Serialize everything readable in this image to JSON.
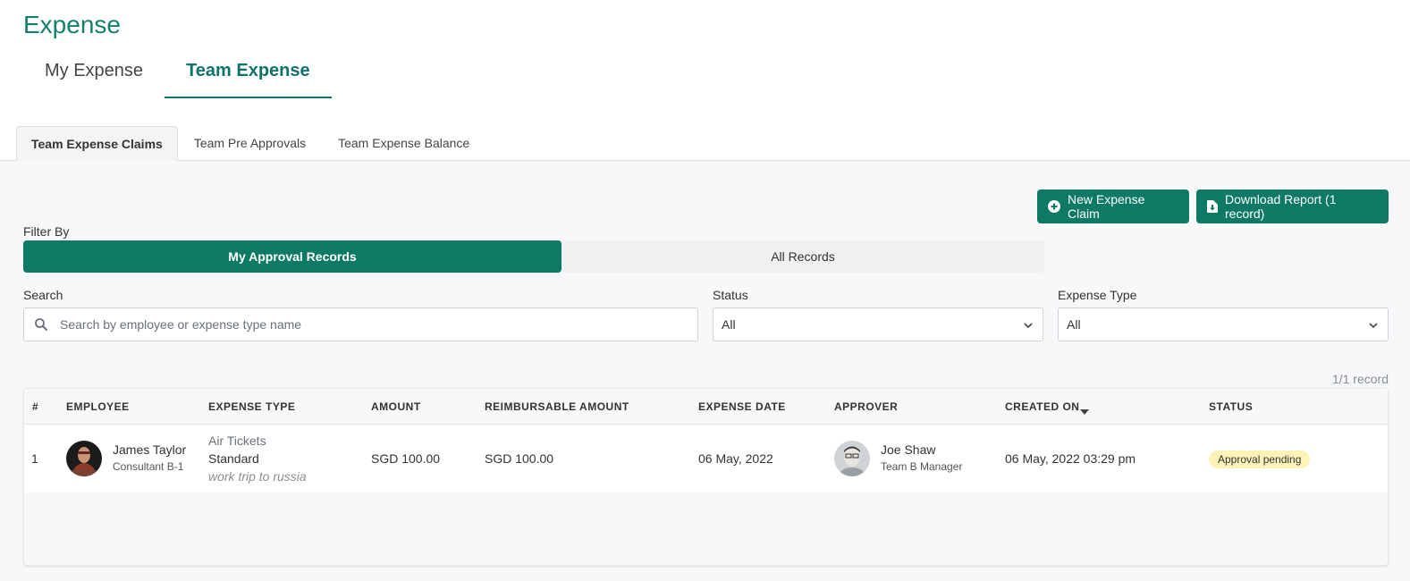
{
  "app": {
    "title": "Expense"
  },
  "main_tabs": [
    {
      "label": "My Expense"
    },
    {
      "label": "Team Expense"
    }
  ],
  "sub_tabs": [
    {
      "label": "Team Expense Claims"
    },
    {
      "label": "Team Pre Approvals"
    },
    {
      "label": "Team Expense Balance"
    }
  ],
  "actions": {
    "new_claim_label": "New Expense Claim",
    "download_label": "Download Report (1 record)"
  },
  "filter": {
    "label": "Filter By",
    "options": [
      "My Approval Records",
      "All Records"
    ]
  },
  "search": {
    "label": "Search",
    "placeholder": "Search by employee or expense type name"
  },
  "status_filter": {
    "label": "Status",
    "value": "All"
  },
  "expense_type_filter": {
    "label": "Expense Type",
    "value": "All"
  },
  "record_count": "1/1 record",
  "table": {
    "columns": [
      "#",
      "EMPLOYEE",
      "EXPENSE TYPE",
      "AMOUNT",
      "REIMBURSABLE AMOUNT",
      "EXPENSE DATE",
      "APPROVER",
      "CREATED ON",
      "STATUS"
    ],
    "rows": [
      {
        "index": "1",
        "employee_name": "James Taylor",
        "employee_role": "Consultant B-1",
        "expense_type": "Air Tickets",
        "expense_category": "Standard",
        "expense_note": "work trip to russia",
        "amount": "SGD 100.00",
        "reimbursable_amount": "SGD 100.00",
        "expense_date": "06 May, 2022",
        "approver_name": "Joe Shaw",
        "approver_role": "Team B Manager",
        "created_on": "06 May, 2022 03:29 pm",
        "status": "Approval pending"
      }
    ]
  },
  "colors": {
    "primary": "#0e7a66",
    "title": "#16806f",
    "badge_bg": "#fdf3b8"
  }
}
